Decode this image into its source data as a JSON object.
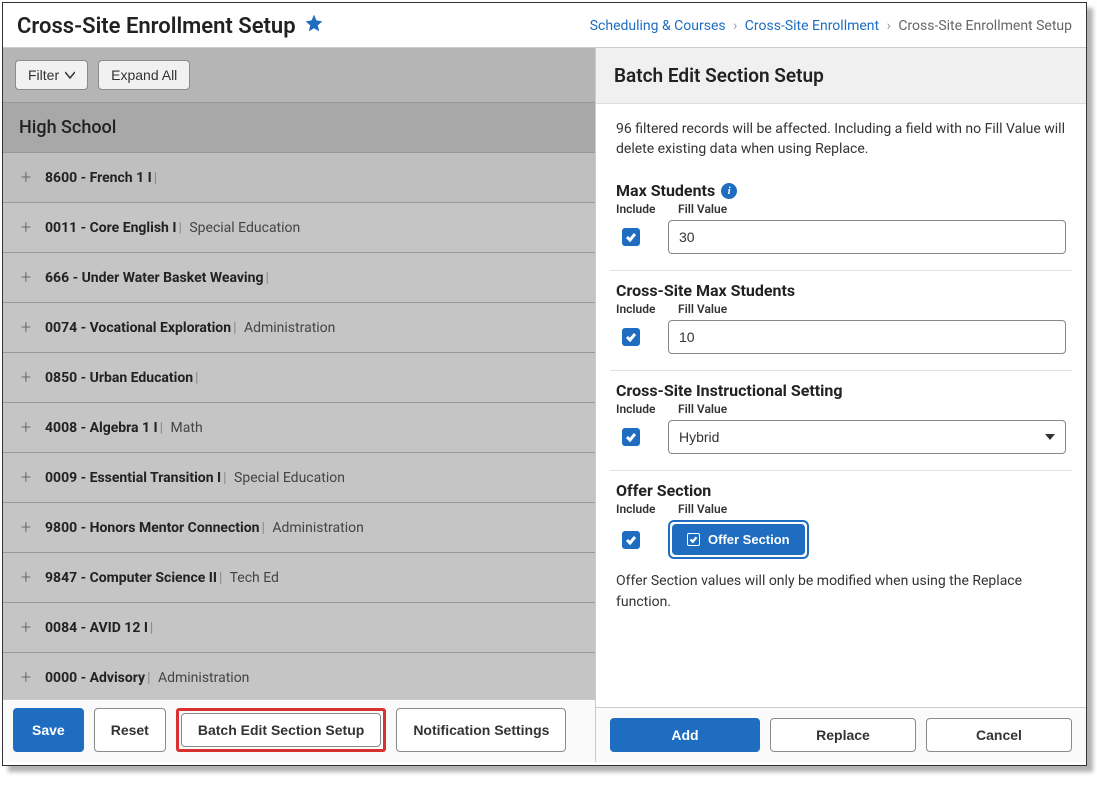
{
  "header": {
    "title": "Cross-Site Enrollment Setup",
    "breadcrumb": {
      "item1": "Scheduling & Courses",
      "item2": "Cross-Site Enrollment",
      "item3": "Cross-Site Enrollment Setup"
    }
  },
  "controls": {
    "filter_label": "Filter",
    "expand_all_label": "Expand All"
  },
  "group": {
    "name": "High School"
  },
  "courses": [
    {
      "code_name": "8600 - French 1 I",
      "dept": ""
    },
    {
      "code_name": "0011 - Core English I",
      "dept": "Special Education"
    },
    {
      "code_name": "666 - Under Water Basket Weaving",
      "dept": ""
    },
    {
      "code_name": "0074 - Vocational Exploration",
      "dept": "Administration"
    },
    {
      "code_name": "0850 - Urban Education",
      "dept": ""
    },
    {
      "code_name": "4008 - Algebra 1 I",
      "dept": "Math"
    },
    {
      "code_name": "0009 - Essential Transition I",
      "dept": "Special Education"
    },
    {
      "code_name": "9800 - Honors Mentor Connection",
      "dept": "Administration"
    },
    {
      "code_name": "9847 - Computer Science II",
      "dept": "Tech Ed"
    },
    {
      "code_name": "0084 - AVID 12 I",
      "dept": ""
    },
    {
      "code_name": "0000 - Advisory",
      "dept": "Administration"
    }
  ],
  "bottom": {
    "save_label": "Save",
    "reset_label": "Reset",
    "batch_edit_label": "Batch Edit Section Setup",
    "notification_label": "Notification Settings"
  },
  "panel": {
    "title": "Batch Edit Section Setup",
    "info": "96 filtered records will be affected. Including a field with no Fill Value will delete existing data when using Replace.",
    "include_label": "Include",
    "fill_value_label": "Fill Value",
    "fields": {
      "max_students": {
        "title": "Max Students",
        "value": "30"
      },
      "cross_max": {
        "title": "Cross-Site Max Students",
        "value": "10"
      },
      "instructional": {
        "title": "Cross-Site Instructional Setting",
        "value": "Hybrid"
      },
      "offer": {
        "title": "Offer Section",
        "button_label": "Offer Section",
        "note": "Offer Section values will only be modified when using the Replace function."
      }
    },
    "footer": {
      "add_label": "Add",
      "replace_label": "Replace",
      "cancel_label": "Cancel"
    }
  }
}
